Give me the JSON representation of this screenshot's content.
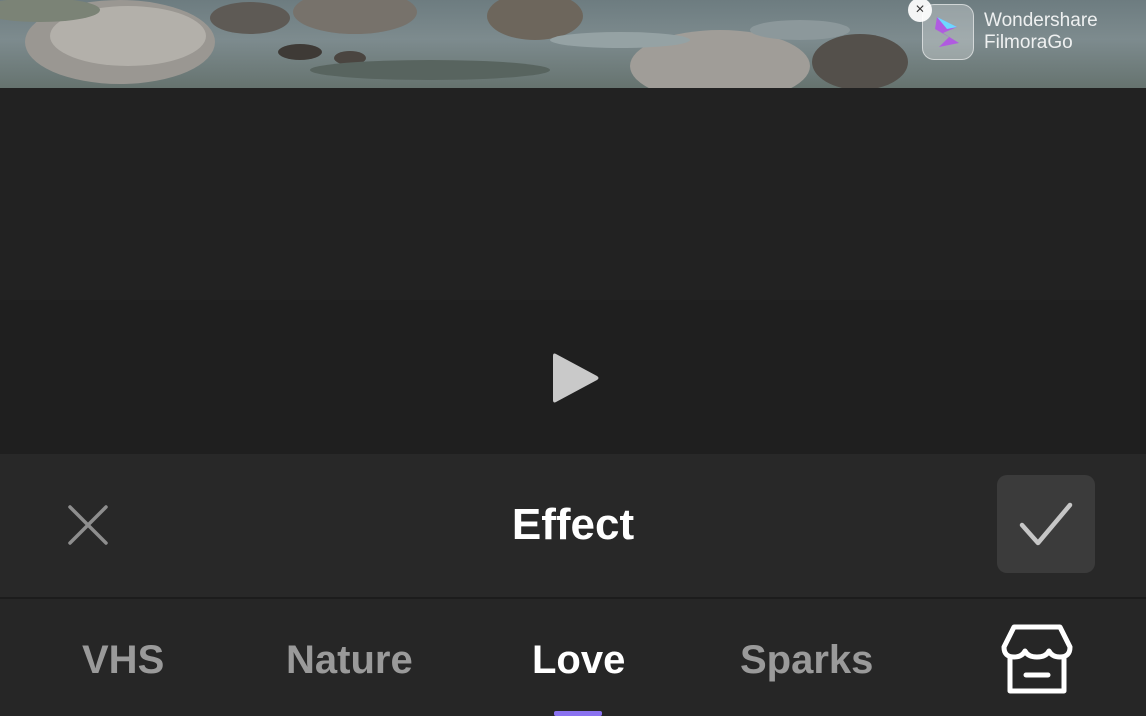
{
  "preview": {
    "watermark": {
      "line1": "Wondershare",
      "line2": "FilmoraGo",
      "close_glyph": "×",
      "icon": "filmorago-logo-icon"
    }
  },
  "player": {
    "play_icon": "play-icon"
  },
  "effect_panel": {
    "title": "Effect",
    "close_icon": "close-icon",
    "confirm_icon": "checkmark-icon"
  },
  "tabs": {
    "items": [
      {
        "label": "VHS",
        "active": false
      },
      {
        "label": "Nature",
        "active": false
      },
      {
        "label": "Love",
        "active": true
      },
      {
        "label": "Sparks",
        "active": false
      }
    ],
    "store_icon": "store-icon",
    "accent_color": "#8a72f0"
  }
}
